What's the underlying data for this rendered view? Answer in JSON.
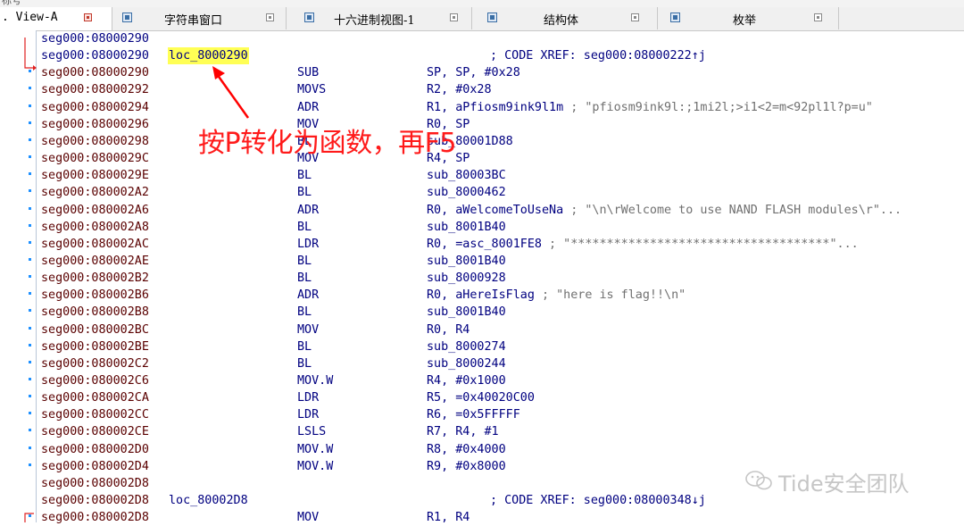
{
  "window": {
    "top_label": "标号"
  },
  "tabs": [
    {
      "label": "View-A",
      "prefix": ".",
      "active": true,
      "icon": "none"
    },
    {
      "label": "字符串窗口",
      "active": false,
      "icon": "strings-window-icon"
    },
    {
      "label": "十六进制视图-1",
      "active": false,
      "icon": "hex-view-icon"
    },
    {
      "label": "结构体",
      "active": false,
      "icon": "structures-icon"
    },
    {
      "label": "枚举",
      "active": false,
      "icon": "enums-icon"
    }
  ],
  "disasm": [
    {
      "addr": "seg000:08000290",
      "label": "",
      "mnemonic": "",
      "operands": "",
      "comment": "",
      "xref": "",
      "dot": false,
      "addr_color": "blue"
    },
    {
      "addr": "seg000:08000290",
      "label": "loc_8000290",
      "mnemonic": "",
      "operands": "",
      "comment": "",
      "xref": "; CODE XREF: seg000:08000222↑j",
      "dot": false,
      "addr_color": "blue"
    },
    {
      "addr": "seg000:08000290",
      "label": "",
      "mnemonic": "SUB",
      "operands": "SP, SP, #0x28",
      "comment": "",
      "xref": "",
      "dot": true
    },
    {
      "addr": "seg000:08000292",
      "label": "",
      "mnemonic": "MOVS",
      "operands": "R2, #0x28",
      "comment": "",
      "xref": "",
      "dot": true
    },
    {
      "addr": "seg000:08000294",
      "label": "",
      "mnemonic": "ADR",
      "operands": "R1, aPfiosm9ink9l1m",
      "comment": " ; \"pfiosm9ink9l:;1mi2l;>i1<2=m<92pl1l?p=u\"",
      "xref": "",
      "dot": true
    },
    {
      "addr": "seg000:08000296",
      "label": "",
      "mnemonic": "MOV",
      "operands": "R0, SP",
      "comment": "",
      "xref": "",
      "dot": true
    },
    {
      "addr": "seg000:08000298",
      "label": "",
      "mnemonic": "BL",
      "operands": "sub_80001D88",
      "comment": "",
      "xref": "",
      "dot": true
    },
    {
      "addr": "seg000:0800029C",
      "label": "",
      "mnemonic": "MOV",
      "operands": "R4, SP",
      "comment": "",
      "xref": "",
      "dot": true
    },
    {
      "addr": "seg000:0800029E",
      "label": "",
      "mnemonic": "BL",
      "operands": "sub_80003BC",
      "comment": "",
      "xref": "",
      "dot": true
    },
    {
      "addr": "seg000:080002A2",
      "label": "",
      "mnemonic": "BL",
      "operands": "sub_8000462",
      "comment": "",
      "xref": "",
      "dot": true
    },
    {
      "addr": "seg000:080002A6",
      "label": "",
      "mnemonic": "ADR",
      "operands": "R0, aWelcomeToUseNa",
      "comment": " ; \"\\n\\rWelcome to use NAND FLASH modules\\r\"...",
      "xref": "",
      "dot": true
    },
    {
      "addr": "seg000:080002A8",
      "label": "",
      "mnemonic": "BL",
      "operands": "sub_8001B40",
      "comment": "",
      "xref": "",
      "dot": true
    },
    {
      "addr": "seg000:080002AC",
      "label": "",
      "mnemonic": "LDR",
      "operands": "R0, =asc_8001FE8",
      "comment": " ; \"************************************\"...",
      "xref": "",
      "dot": true
    },
    {
      "addr": "seg000:080002AE",
      "label": "",
      "mnemonic": "BL",
      "operands": "sub_8001B40",
      "comment": "",
      "xref": "",
      "dot": true
    },
    {
      "addr": "seg000:080002B2",
      "label": "",
      "mnemonic": "BL",
      "operands": "sub_8000928",
      "comment": "",
      "xref": "",
      "dot": true
    },
    {
      "addr": "seg000:080002B6",
      "label": "",
      "mnemonic": "ADR",
      "operands": "R0, aHereIsFlag",
      "comment": " ; \"here is flag!!\\n\"",
      "xref": "",
      "dot": true
    },
    {
      "addr": "seg000:080002B8",
      "label": "",
      "mnemonic": "BL",
      "operands": "sub_8001B40",
      "comment": "",
      "xref": "",
      "dot": true
    },
    {
      "addr": "seg000:080002BC",
      "label": "",
      "mnemonic": "MOV",
      "operands": "R0, R4",
      "comment": "",
      "xref": "",
      "dot": true
    },
    {
      "addr": "seg000:080002BE",
      "label": "",
      "mnemonic": "BL",
      "operands": "sub_8000274",
      "comment": "",
      "xref": "",
      "dot": true
    },
    {
      "addr": "seg000:080002C2",
      "label": "",
      "mnemonic": "BL",
      "operands": "sub_8000244",
      "comment": "",
      "xref": "",
      "dot": true
    },
    {
      "addr": "seg000:080002C6",
      "label": "",
      "mnemonic": "MOV.W",
      "operands": "R4, #0x1000",
      "comment": "",
      "xref": "",
      "dot": true
    },
    {
      "addr": "seg000:080002CA",
      "label": "",
      "mnemonic": "LDR",
      "operands": "R5, =0x40020C00",
      "comment": "",
      "xref": "",
      "dot": true
    },
    {
      "addr": "seg000:080002CC",
      "label": "",
      "mnemonic": "LDR",
      "operands": "R6, =0x5FFFFF",
      "comment": "",
      "xref": "",
      "dot": true
    },
    {
      "addr": "seg000:080002CE",
      "label": "",
      "mnemonic": "LSLS",
      "operands": "R7, R4, #1",
      "comment": "",
      "xref": "",
      "dot": true
    },
    {
      "addr": "seg000:080002D0",
      "label": "",
      "mnemonic": "MOV.W",
      "operands": "R8, #0x4000",
      "comment": "",
      "xref": "",
      "dot": true
    },
    {
      "addr": "seg000:080002D4",
      "label": "",
      "mnemonic": "MOV.W",
      "operands": "R9, #0x8000",
      "comment": "",
      "xref": "",
      "dot": true
    },
    {
      "addr": "seg000:080002D8",
      "label": "",
      "mnemonic": "",
      "operands": "",
      "comment": "",
      "xref": "",
      "dot": false
    },
    {
      "addr": "seg000:080002D8",
      "label": "loc_80002D8",
      "mnemonic": "",
      "operands": "",
      "comment": "",
      "xref": "; CODE XREF: seg000:08000348↓j",
      "dot": false
    },
    {
      "addr": "seg000:080002D8",
      "label": "",
      "mnemonic": "MOV",
      "operands": "R1, R4",
      "comment": "",
      "xref": "",
      "dot": true
    }
  ],
  "annotation": {
    "text": "按P转化为函数，再F5",
    "color": "#ff1a1a"
  },
  "watermark": {
    "text": "Tide安全团队"
  },
  "colors": {
    "highlight": "#ffff55",
    "code": "#000080",
    "addr": "#5a0000",
    "comment": "#707070",
    "arrow": "#ff0000"
  }
}
